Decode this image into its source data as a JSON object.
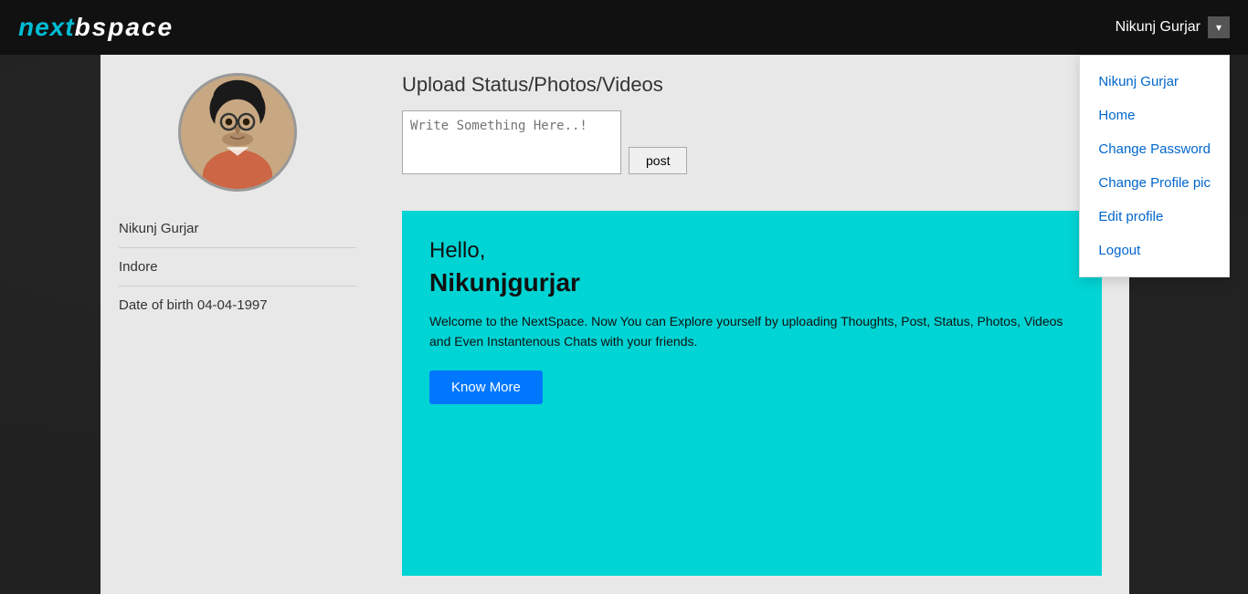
{
  "navbar": {
    "logo_next": "next",
    "logo_space": "bspace",
    "username": "Nikunj Gurjar",
    "dropdown_arrow": "▾"
  },
  "dropdown": {
    "items": [
      {
        "label": "Nikunj Gurjar",
        "id": "profile-name"
      },
      {
        "label": "Home",
        "id": "home"
      },
      {
        "label": "Change Password",
        "id": "change-password"
      },
      {
        "label": "Change Profile pic",
        "id": "change-profile-pic"
      },
      {
        "label": "Edit profile",
        "id": "edit-profile"
      },
      {
        "label": "Logout",
        "id": "logout"
      }
    ]
  },
  "profile": {
    "name": "Nikunj Gurjar",
    "location": "Indore",
    "dob_label": "Date of birth 04-04-1997"
  },
  "upload": {
    "title": "Upload Status/Photos/Videos",
    "textarea_placeholder": "Write Something Here..!",
    "post_button": "post"
  },
  "welcome": {
    "hello": "Hello,",
    "username": "Nikunjgurjar",
    "text": "Welcome to the NextSpace. Now You can Explore yourself by uploading Thoughts, Post, Status, Photos, Videos and Even Instantenous Chats with your friends.",
    "cta_button": "Know More"
  }
}
